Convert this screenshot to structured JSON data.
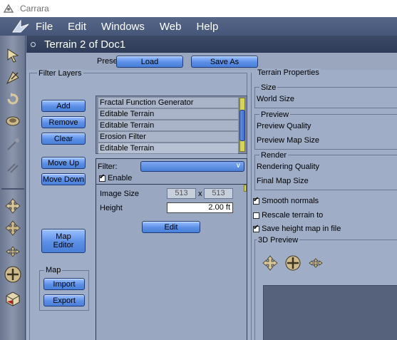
{
  "window": {
    "title": "Carrara",
    "icon": "carrara-app-icon"
  },
  "menubar": {
    "logo": "carrara-logo-icon",
    "items": [
      "File",
      "Edit",
      "Windows",
      "Web",
      "Help"
    ]
  },
  "toolbar": {
    "tools": [
      "select-arrow-icon",
      "move-icon",
      "rotate-icon",
      "ring-icon",
      "disabled-tool-icon",
      "disabled-link-icon",
      "move-4way-icon",
      "move-cross-icon",
      "move-cross-small-icon",
      "dolly-icon",
      "cube-view-icon"
    ]
  },
  "document": {
    "title": "Terrain 2 of Doc1"
  },
  "preset": {
    "label": "Preset:",
    "load": "Load",
    "save_as": "Save As"
  },
  "filter_layers": {
    "title": "Filter Layers",
    "buttons": {
      "add": "Add",
      "remove": "Remove",
      "clear": "Clear",
      "move_up": "Move Up",
      "move_down": "Move Down",
      "map_editor_1": "Map",
      "map_editor_2": "Editor"
    },
    "map_group": {
      "title": "Map",
      "import": "Import",
      "export": "Export"
    },
    "layers": [
      "Fractal Function Generator",
      "Editable Terrain",
      "Editable Terrain",
      "Erosion Filter",
      "Editable Terrain"
    ],
    "filter_label": "Filter:",
    "enable_label": "Enable",
    "enable_checked": true,
    "image_size_label": "Image Size",
    "image_size_w": "513",
    "image_size_x": "x",
    "image_size_h": "513",
    "height_label": "Height",
    "height_value": "2.00 ft",
    "edit_button": "Edit"
  },
  "terrain_properties": {
    "title": "Terrain Properties",
    "size_title": "Size",
    "world_size": "World Size",
    "preview_title": "Preview",
    "preview_quality": "Preview Quality",
    "preview_map_size": "Preview Map Size",
    "render_title": "Render",
    "rendering_quality": "Rendering Quality",
    "final_map_size": "Final Map Size",
    "smooth_normals": "Smooth normals",
    "smooth_normals_checked": true,
    "rescale_terrain": "Rescale terrain to",
    "rescale_checked": false,
    "save_height_map": "Save height map in file",
    "save_height_map_checked": true,
    "preview_3d_title": "3D Preview",
    "preview_3d_tools": [
      "move-4way-icon",
      "dolly-icon",
      "move-cross-small-icon"
    ]
  },
  "colors": {
    "accent_button": "#5b8fe6",
    "panel_bg": "#9fadc6",
    "header_bg": "#3c4a68"
  }
}
